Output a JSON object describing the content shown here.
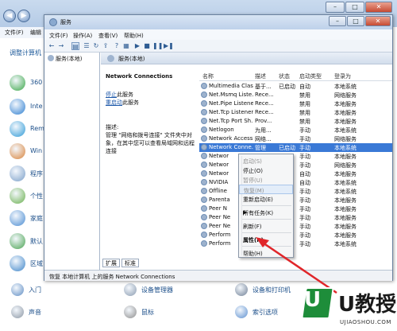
{
  "background_window": {
    "menu": {
      "file": "文件(F)",
      "edit": "编辑"
    },
    "panel_title": "调整计算机",
    "items": [
      {
        "label": "360",
        "icon": "shield-icon",
        "color": "#3aa647"
      },
      {
        "label": "Inte",
        "icon": "internet-options-icon",
        "color": "#2f7fd0"
      },
      {
        "label": "Rem",
        "icon": "remote-app-icon",
        "color": "#2f9ad6"
      },
      {
        "label": "Win",
        "icon": "windows-icon",
        "color": "#d8833a"
      },
      {
        "label": "程序",
        "icon": "programs-icon",
        "color": "#7b9fc8"
      },
      {
        "label": "个性",
        "icon": "personalization-icon",
        "color": "#6bb04f"
      },
      {
        "label": "家庭",
        "icon": "homegroup-icon",
        "color": "#4a8bd1"
      },
      {
        "label": "默认",
        "icon": "default-programs-icon",
        "color": "#48a24f"
      },
      {
        "label": "区域",
        "icon": "region-icon",
        "color": "#3f86c9"
      }
    ],
    "bottom_items": [
      {
        "label": "入门",
        "icon": "getting-started-icon",
        "color": "#5f8dc3"
      },
      {
        "label": "设备管理器",
        "icon": "device-manager-icon",
        "color": "#8a9bb0"
      },
      {
        "label": "设备和打印机",
        "icon": "devices-printers-icon",
        "color": "#6f7f95"
      },
      {
        "label": "声音",
        "icon": "sound-icon",
        "color": "#8b96a3"
      },
      {
        "label": "鼠标",
        "icon": "mouse-icon",
        "color": "#8d8d8d"
      },
      {
        "label": "索引选项",
        "icon": "indexing-icon",
        "color": "#5c8fcf"
      }
    ]
  },
  "services_window": {
    "title": "服务",
    "menu": [
      "文件(F)",
      "操作(A)",
      "查看(V)",
      "帮助(H)"
    ],
    "tree_item": "服务(本地)",
    "main_header": "服务(本地)",
    "detail": {
      "name": "Network Connections",
      "link_stop_prefix": "停止",
      "link_stop_suffix": "此服务",
      "link_restart_prefix": "重启动",
      "link_restart_suffix": "此服务",
      "desc_label": "描述:",
      "desc": "管理 \"网络和拨号连接\" 文件夹中对象，在其中您可以查看局域网和远程连接"
    },
    "columns": [
      "名称",
      "描述",
      "状态",
      "启动类型",
      "登录为"
    ],
    "rows": [
      {
        "name": "Multimedia Clas...",
        "desc": "基于...",
        "status": "已启动",
        "startup": "自动",
        "logon": "本地系统"
      },
      {
        "name": "Net.Msmq Liste...",
        "desc": "Rece...",
        "status": "",
        "startup": "禁用",
        "logon": "网络服务"
      },
      {
        "name": "Net.Pipe Listene...",
        "desc": "Rece...",
        "status": "",
        "startup": "禁用",
        "logon": "本地服务"
      },
      {
        "name": "Net.Tcp Listener...",
        "desc": "Rece...",
        "status": "",
        "startup": "禁用",
        "logon": "本地服务"
      },
      {
        "name": "Net.Tcp Port Sh...",
        "desc": "Prov...",
        "status": "",
        "startup": "禁用",
        "logon": "本地服务"
      },
      {
        "name": "Netlogon",
        "desc": "为用...",
        "status": "",
        "startup": "手动",
        "logon": "本地系统"
      },
      {
        "name": "Network Access ...",
        "desc": "网络...",
        "status": "",
        "startup": "手动",
        "logon": "网络服务"
      },
      {
        "name": "Network Conne...",
        "desc": "管理",
        "status": "已启动",
        "startup": "手动",
        "logon": "本地系统",
        "selected": true
      },
      {
        "name": "Networ",
        "desc": "",
        "status": "",
        "startup": "手动",
        "logon": "本地服务"
      },
      {
        "name": "Networ",
        "desc": "",
        "status": "",
        "startup": "手动",
        "logon": "网络服务"
      },
      {
        "name": "Networ",
        "desc": "",
        "status": "",
        "startup": "自动",
        "logon": "本地服务"
      },
      {
        "name": "NVIDIA",
        "desc": "",
        "status": "",
        "startup": "自动",
        "logon": "本地系统"
      },
      {
        "name": "Offline",
        "desc": "",
        "status": "",
        "startup": "手动",
        "logon": "本地系统"
      },
      {
        "name": "Parenta",
        "desc": "",
        "status": "",
        "startup": "手动",
        "logon": "本地服务"
      },
      {
        "name": "Peer N",
        "desc": "",
        "status": "",
        "startup": "手动",
        "logon": "本地服务"
      },
      {
        "name": "Peer Ne",
        "desc": "",
        "status": "",
        "startup": "手动",
        "logon": "本地服务"
      },
      {
        "name": "Peer Ne",
        "desc": "",
        "status": "",
        "startup": "手动",
        "logon": "本地服务"
      },
      {
        "name": "Perform",
        "desc": "",
        "status": "",
        "startup": "手动",
        "logon": "本地服务"
      },
      {
        "name": "Perform",
        "desc": "",
        "status": "",
        "startup": "手动",
        "logon": "本地系统"
      }
    ],
    "tabs": [
      "扩展",
      "标准"
    ],
    "status_bar": "恢复 本地计算机 上的服务 Network Connections"
  },
  "context_menu": {
    "items": [
      {
        "label": "启动(S)",
        "disabled": true
      },
      {
        "label": "停止(O)",
        "disabled": false
      },
      {
        "label": "暂停(U)",
        "disabled": true
      },
      {
        "label": "恢复(M)",
        "disabled": true,
        "highlight": true
      },
      {
        "label": "重新启动(E)",
        "disabled": false
      },
      {
        "separator": true
      },
      {
        "label": "所有任务(K)",
        "disabled": false,
        "submenu": true
      },
      {
        "separator": true
      },
      {
        "label": "刷新(F)",
        "disabled": false
      },
      {
        "separator": true
      },
      {
        "label": "属性(R)",
        "disabled": false,
        "bold": true
      },
      {
        "separator": true
      },
      {
        "label": "帮助(H)",
        "disabled": false
      }
    ]
  },
  "watermark": {
    "brand": "U教授",
    "badge_glyph": "U",
    "url": "UJIAOSHOU.COM"
  },
  "colors": {
    "selection": "#3a79d6",
    "annotation_arrow": "#e0262a",
    "watermark_green": "#1e8d3a"
  }
}
